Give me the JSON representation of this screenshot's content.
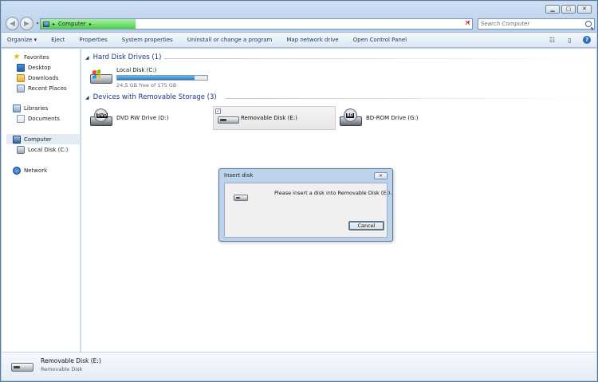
{
  "window": {
    "controls": {
      "minimize": "▁",
      "maximize": "▢",
      "close": "✕"
    }
  },
  "address_bar": {
    "segment": "Computer",
    "load_progress": 0.22,
    "progress_color": "#4fd14c"
  },
  "search": {
    "placeholder": "Search Computer"
  },
  "toolbar": {
    "organize": "Organize ▾",
    "eject": "Eject",
    "properties": "Properties",
    "system_properties": "System properties",
    "uninstall": "Uninstall or change a program",
    "map_network_drive": "Map network drive",
    "open_control_panel": "Open Control Panel",
    "help": "?"
  },
  "nav_pane": {
    "favorites": "Favorites",
    "desktop": "Desktop",
    "downloads": "Downloads",
    "recent_places": "Recent Places",
    "libraries": "Libraries",
    "documents": "Documents",
    "computer": "Computer",
    "local_disk": "Local Disk (C:)",
    "network": "Network"
  },
  "content": {
    "hdd_group": "Hard Disk Drives (1)",
    "removable_group": "Devices with Removable Storage (3)",
    "local_disk": {
      "name": "Local Disk (C:)",
      "free": "24,5 GB free of 175 GB",
      "used_fraction": 0.86,
      "bar_color": "#1f78c1"
    },
    "dvd": {
      "name": "DVD RW Drive (D:)",
      "label": "DVD"
    },
    "removable": {
      "name": "Removable Disk (E:)",
      "checked": "✓"
    },
    "bdrom": {
      "name": "BD-ROM Drive (G:)",
      "label": "BD"
    }
  },
  "dialog": {
    "title": "Insert disk",
    "close": "✕",
    "message": "Please insert a disk into Removable Disk (E:).",
    "cancel": "Cancel"
  },
  "details": {
    "name": "Removable Disk (E:)",
    "type": "Removable Disk"
  }
}
